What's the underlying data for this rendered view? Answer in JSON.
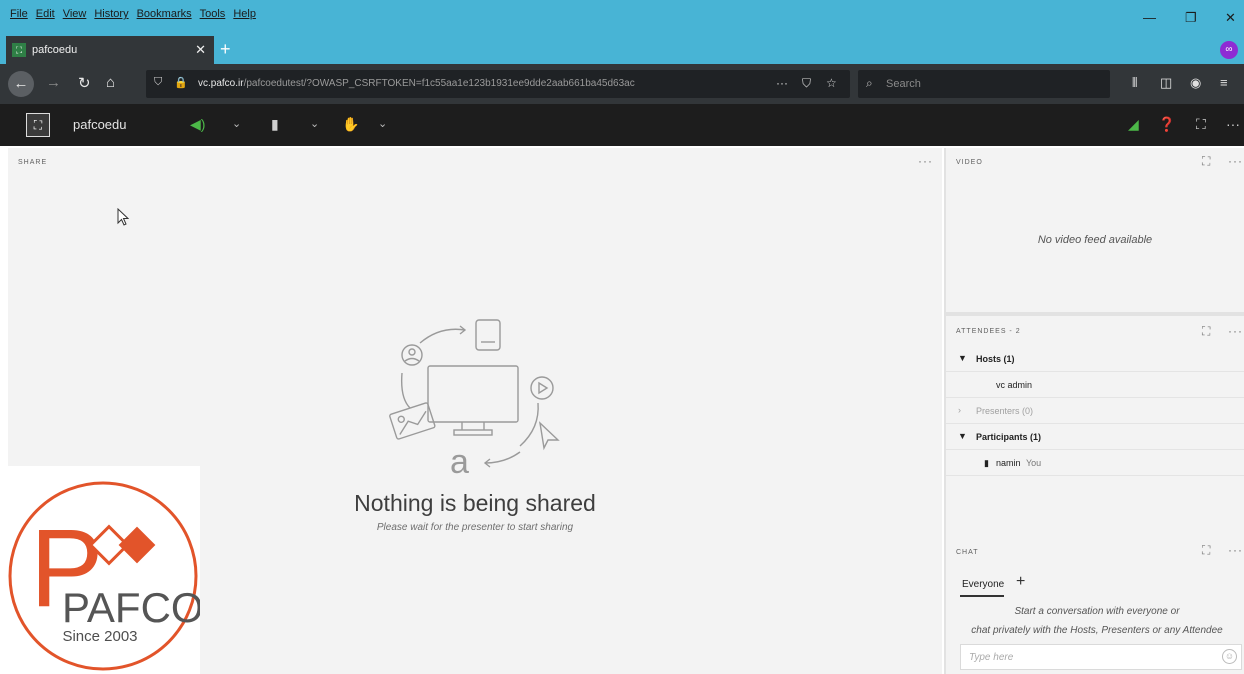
{
  "browser": {
    "menu": [
      "File",
      "Edit",
      "View",
      "History",
      "Bookmarks",
      "Tools",
      "Help"
    ],
    "tab_title": "pafcoedu",
    "url_domain": "vc.pafco.ir",
    "url_path": "/pafcoedutest/?OWASP_CSRFTOKEN=f1c55aa1e123b1931ee9dde2aab661ba45d63ac",
    "search_placeholder": "Search"
  },
  "app": {
    "name": "pafcoedu"
  },
  "share": {
    "title": "SHARE",
    "empty_title": "Nothing is being shared",
    "empty_subtitle": "Please wait for the presenter to start sharing"
  },
  "video": {
    "title": "VIDEO",
    "empty": "No video feed available"
  },
  "attendees": {
    "title": "ATTENDEES - 2",
    "groups": [
      {
        "label": "Hosts (1)"
      },
      {
        "label": "Presenters (0)"
      },
      {
        "label": "Participants (1)"
      }
    ],
    "host_name": "vc admin",
    "participant_name": "namin",
    "participant_you": "You"
  },
  "chat": {
    "title": "CHAT",
    "tab": "Everyone",
    "message_line1": "Start a conversation with everyone or",
    "message_line2": "chat privately with the Hosts, Presenters or any Attendee",
    "input_placeholder": "Type here"
  },
  "watermark": {
    "letters": "PAFCO",
    "since": "Since 2003"
  },
  "colors": {
    "titlebar": "#48b4d5",
    "toolbar": "#323639",
    "appbar": "#1d1d1d",
    "brand_orange": "#e2542a"
  }
}
